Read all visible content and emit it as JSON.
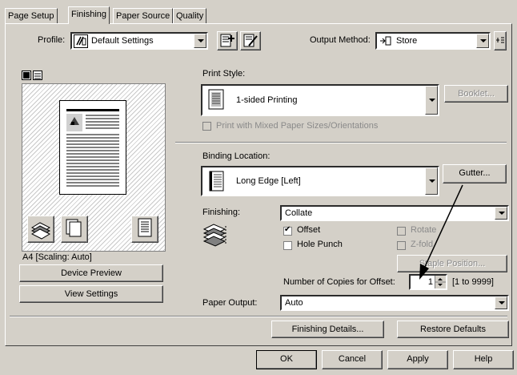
{
  "tabs": [
    "Page Setup",
    "Finishing",
    "Paper Source",
    "Quality"
  ],
  "profile": {
    "label": "Profile:",
    "value": "Default Settings"
  },
  "output_method": {
    "label": "Output Method:",
    "value": "Store"
  },
  "preview": {
    "caption": "A4 [Scaling: Auto]",
    "device_preview_btn": "Device Preview",
    "view_settings_btn": "View Settings"
  },
  "print_style": {
    "label": "Print Style:",
    "value": "1-sided Printing",
    "booklet_btn": "Booklet...",
    "mixed_sizes": "Print with Mixed Paper Sizes/Orientations"
  },
  "binding": {
    "label": "Binding Location:",
    "value": "Long Edge [Left]",
    "gutter_btn": "Gutter..."
  },
  "finishing": {
    "label": "Finishing:",
    "value": "Collate",
    "offset": "Offset",
    "hole_punch": "Hole Punch",
    "rotate": "Rotate",
    "zfold": "Z-fold",
    "staple_btn": "Staple Position..."
  },
  "copies": {
    "label": "Number of Copies for Offset:",
    "value": "1",
    "range": "[1 to 9999]"
  },
  "paper_output": {
    "label": "Paper Output:",
    "value": "Auto"
  },
  "buttons": {
    "finishing_details": "Finishing Details...",
    "restore_defaults": "Restore Defaults",
    "ok": "OK",
    "cancel": "Cancel",
    "apply": "Apply",
    "help": "Help"
  }
}
